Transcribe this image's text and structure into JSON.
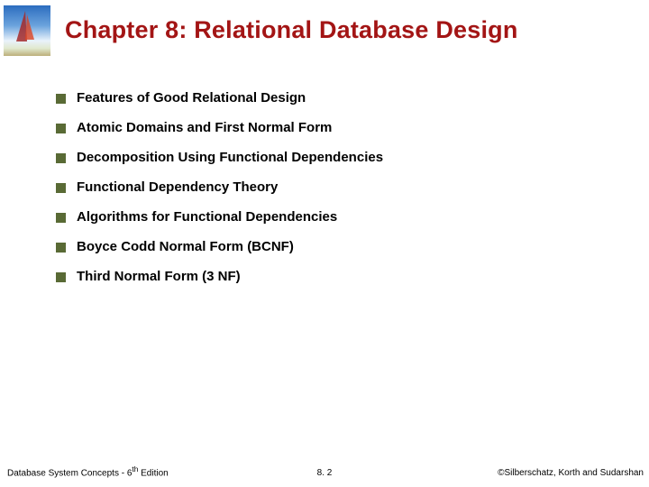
{
  "title": "Chapter 8:  Relational Database Design",
  "bullets": [
    "Features of Good Relational Design",
    "Atomic Domains and First Normal Form",
    "Decomposition Using Functional Dependencies",
    "Functional Dependency Theory",
    "Algorithms for Functional Dependencies",
    "Boyce Codd Normal Form (BCNF)",
    "Third Normal Form (3 NF)"
  ],
  "footer": {
    "left_prefix": "Database System Concepts - 6",
    "left_sup": "th",
    "left_suffix": " Edition",
    "center": "8. 2",
    "right": "©Silberschatz, Korth and Sudarshan"
  }
}
